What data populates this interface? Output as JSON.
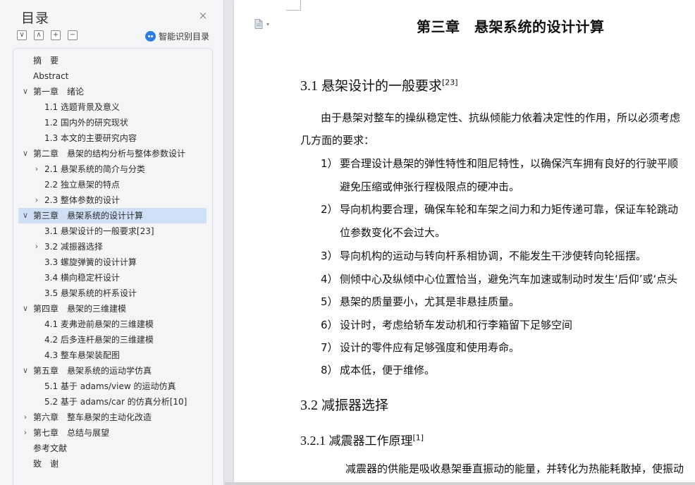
{
  "toc_panel": {
    "title": "目录",
    "close_icon": "×",
    "toolbar": {
      "collapse_all": "∨",
      "expand_all": "∧",
      "increase_level": "+",
      "decrease_level": "−"
    },
    "smart_toc_label": "智能识别目录",
    "items": [
      {
        "label": "摘　要",
        "level": 1,
        "caret": ""
      },
      {
        "label": "Abstract",
        "level": 1,
        "caret": ""
      },
      {
        "label": "第一章　绪论",
        "level": 1,
        "caret": "∨"
      },
      {
        "label": "1.1 选题背景及意义",
        "level": 2,
        "caret": ""
      },
      {
        "label": "1.2 国内外的研究现状",
        "level": 2,
        "caret": ""
      },
      {
        "label": "1.3 本文的主要研究内容",
        "level": 2,
        "caret": ""
      },
      {
        "label": "第二章　悬架的结构分析与整体参数设计",
        "level": 1,
        "caret": "∨"
      },
      {
        "label": "2.1 悬架系统的简介与分类",
        "level": 2,
        "caret": "›"
      },
      {
        "label": "2.2 独立悬架的特点",
        "level": 2,
        "caret": ""
      },
      {
        "label": "2.3 整体参数的设计",
        "level": 2,
        "caret": "›"
      },
      {
        "label": "第三章　悬架系统的设计计算",
        "level": 1,
        "caret": "∨",
        "selected": true
      },
      {
        "label": "3.1 悬架设计的一般要求[23]",
        "level": 2,
        "caret": ""
      },
      {
        "label": "3.2 减振器选择",
        "level": 2,
        "caret": "›"
      },
      {
        "label": "3.3 螺旋弹簧的设计计算",
        "level": 2,
        "caret": ""
      },
      {
        "label": "3.4 横向稳定杆设计",
        "level": 2,
        "caret": ""
      },
      {
        "label": "3.5 悬架系统的杆系设计",
        "level": 2,
        "caret": ""
      },
      {
        "label": "第四章　悬架的三维建模",
        "level": 1,
        "caret": "∨"
      },
      {
        "label": "4.1 麦弗逊前悬架的三维建模",
        "level": 2,
        "caret": ""
      },
      {
        "label": "4.2 后多连杆悬架的三维建模",
        "level": 2,
        "caret": ""
      },
      {
        "label": "4.3 整车悬架装配图",
        "level": 2,
        "caret": ""
      },
      {
        "label": "第五章　悬架系统的运动学仿真",
        "level": 1,
        "caret": "∨"
      },
      {
        "label": "5.1 基于 adams/view 的运动仿真",
        "level": 2,
        "caret": ""
      },
      {
        "label": "5.2 基于 adams/car 的仿真分析[10]",
        "level": 2,
        "caret": ""
      },
      {
        "label": "第六章　整车悬架的主动化改造",
        "level": 1,
        "caret": "›"
      },
      {
        "label": "第七章　总结与展望",
        "level": 1,
        "caret": "›"
      },
      {
        "label": "参考文献",
        "level": 1,
        "caret": ""
      },
      {
        "label": "致　谢",
        "level": 1,
        "caret": ""
      }
    ]
  },
  "document": {
    "page_icon": "document-icon",
    "chapter_title": "第三章　悬架系统的设计计算",
    "section_31": {
      "num": "3.1 ",
      "text": "悬架设计的一般要求",
      "ref": "[23]"
    },
    "intro_line1": "由于悬架对整车的操纵稳定性、抗纵倾能力依着决定性的作用，所以必须考虑",
    "intro_line2": "几方面的要求：",
    "requirements": [
      {
        "num": "1）",
        "text": "要合理设计悬架的弹性特性和阻尼特性，以确保汽车拥有良好的行驶平顺"
      },
      {
        "num": "",
        "text": "避免压缩或伸张行程极限点的硬冲击。"
      },
      {
        "num": "2）",
        "text": "导向机构要合理，确保车轮和车架之间力和力矩传递可靠，保证车轮跳动"
      },
      {
        "num": "",
        "text": "位参数变化不会过大。"
      },
      {
        "num": "3）",
        "text": "导向机构的运动与转向杆系相协调，不能发生干涉使转向轮摇摆。"
      },
      {
        "num": "4）",
        "text": "侧倾中心及纵倾中心位置恰当，避免汽车加速或制动时发生‘后仰’或‘点头"
      },
      {
        "num": "5）",
        "text": "悬架的质量要小，尤其是非悬挂质量。"
      },
      {
        "num": "6）",
        "text": "设计时，考虑给轿车发动机和行李箱留下足够空间"
      },
      {
        "num": "7）",
        "text": "设计的零件应有足够强度和使用寿命。"
      },
      {
        "num": "8）",
        "text": "成本低，便于维修。"
      }
    ],
    "section_32": {
      "num": "3.2 ",
      "text": "减振器选择"
    },
    "section_321": {
      "num": "3.2.1 ",
      "text": "减震器工作原理",
      "ref": "[1]"
    },
    "body_line": "减震器的供能是吸收悬架垂直振动的能量，并转化为热能耗散掉，使振动"
  },
  "colors": {
    "selected_bg": "#cfdff5",
    "smart_icon": "#2f7de1",
    "panel_bg": "#f4f5f7"
  }
}
